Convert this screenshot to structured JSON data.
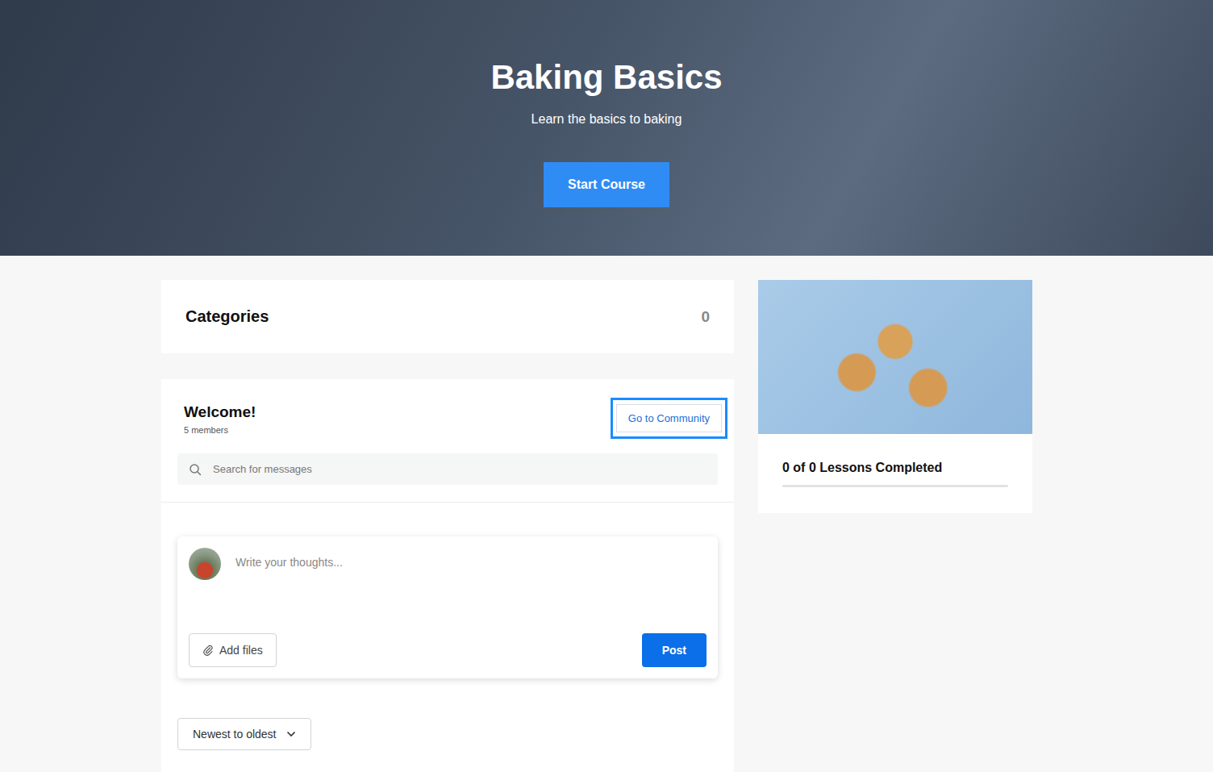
{
  "course": {
    "title": "Baking Basics",
    "subtitle": "Learn the basics to baking",
    "start_button": "Start Course"
  },
  "categories": {
    "title": "Categories",
    "count": "0"
  },
  "community": {
    "title": "Welcome!",
    "members": "5 members",
    "go_button": {
      "label": "Go to Community",
      "highlighted": true
    },
    "search": {
      "placeholder": "Search for messages"
    },
    "composer": {
      "placeholder": "Write your thoughts...",
      "add_files": "Add files",
      "post": "Post"
    },
    "sort": {
      "value": "Newest to oldest"
    }
  },
  "progress": {
    "label": "0 of 0 Lessons Completed",
    "level": 0
  }
}
